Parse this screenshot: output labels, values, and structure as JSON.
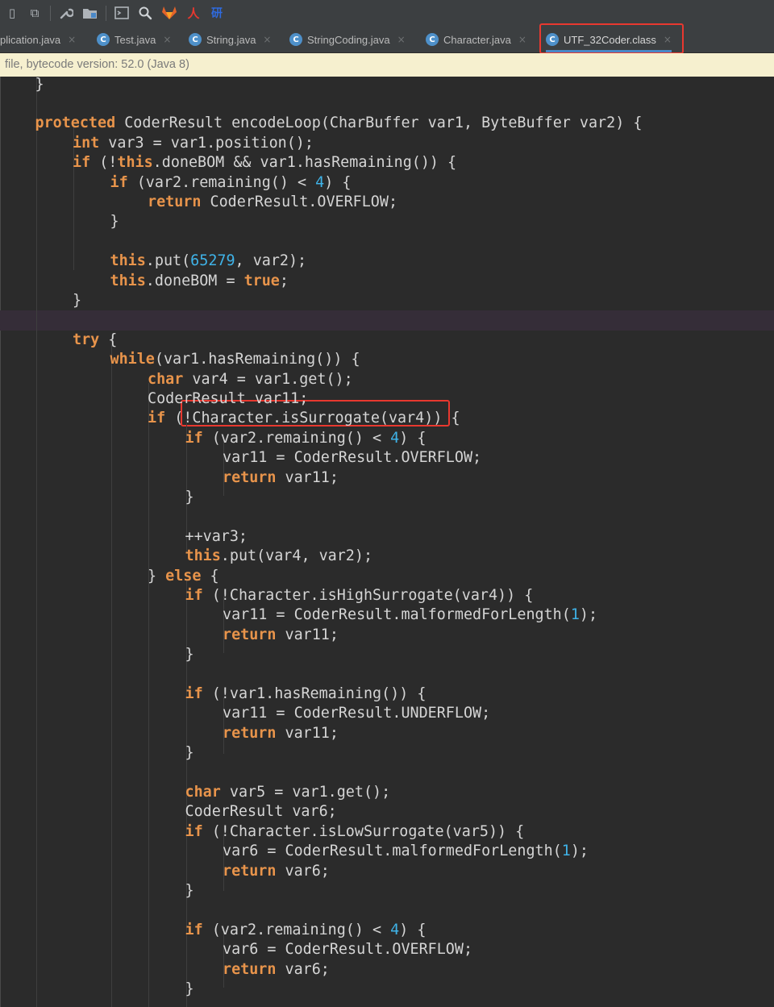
{
  "toolbar": {
    "icons": [
      "close-tab-icon",
      "fork-icon",
      "wrench-icon",
      "folder-settings-icon",
      "terminal-icon",
      "search-icon",
      "gitlab-icon",
      "translate-icon",
      "dictionary-icon"
    ]
  },
  "tabs": [
    {
      "name": "plication.java",
      "icon": false,
      "active": false
    },
    {
      "name": "Test.java",
      "icon": true,
      "active": false
    },
    {
      "name": "String.java",
      "icon": true,
      "active": false
    },
    {
      "name": "StringCoding.java",
      "icon": true,
      "active": false
    },
    {
      "name": "Character.java",
      "icon": true,
      "active": false
    },
    {
      "name": "UTF_32Coder.class",
      "icon": true,
      "active": true
    }
  ],
  "banner": {
    "text": " file, bytecode version: 52.0 (Java 8)"
  },
  "colors": {
    "highlight_box": "#e8382f",
    "keyword": "#e8944b",
    "number": "#3fb3e8",
    "text": "#d5d5d5",
    "background": "#2b2b2b"
  },
  "code": {
    "lines": [
      {
        "indent": 1,
        "tokens": [
          [
            "}",
            "p"
          ]
        ]
      },
      {
        "indent": 0,
        "tokens": []
      },
      {
        "indent": 1,
        "tokens": [
          [
            "protected",
            "k"
          ],
          [
            " CoderResult encodeLoop(CharBuffer var1, ByteBuffer var2) {",
            "p"
          ]
        ]
      },
      {
        "indent": 2,
        "tokens": [
          [
            "int",
            "k"
          ],
          [
            " var3 = var1.position();",
            "p"
          ]
        ]
      },
      {
        "indent": 2,
        "tokens": [
          [
            "if",
            "k"
          ],
          [
            " (!",
            "p"
          ],
          [
            "this",
            "k"
          ],
          [
            ".doneBOM && var1.hasRemaining()) {",
            "p"
          ]
        ]
      },
      {
        "indent": 3,
        "tokens": [
          [
            "if",
            "k"
          ],
          [
            " (var2.remaining() < ",
            "p"
          ],
          [
            "4",
            "n"
          ],
          [
            ") {",
            "p"
          ]
        ]
      },
      {
        "indent": 4,
        "tokens": [
          [
            "return",
            "k"
          ],
          [
            " CoderResult.OVERFLOW;",
            "p"
          ]
        ]
      },
      {
        "indent": 3,
        "tokens": [
          [
            "}",
            "p"
          ]
        ]
      },
      {
        "indent": 0,
        "tokens": []
      },
      {
        "indent": 3,
        "tokens": [
          [
            "this",
            "k"
          ],
          [
            ".put(",
            "p"
          ],
          [
            "65279",
            "n"
          ],
          [
            ", var2);",
            "p"
          ]
        ]
      },
      {
        "indent": 3,
        "tokens": [
          [
            "this",
            "k"
          ],
          [
            ".doneBOM = ",
            "p"
          ],
          [
            "true",
            "k"
          ],
          [
            ";",
            "p"
          ]
        ]
      },
      {
        "indent": 2,
        "tokens": [
          [
            "}",
            "p"
          ]
        ]
      },
      {
        "indent": 0,
        "tokens": [],
        "caret": true
      },
      {
        "indent": 2,
        "tokens": [
          [
            "try",
            "k"
          ],
          [
            " {",
            "p"
          ]
        ]
      },
      {
        "indent": 3,
        "tokens": [
          [
            "while",
            "k"
          ],
          [
            "(var1.hasRemaining()) {",
            "p"
          ]
        ]
      },
      {
        "indent": 4,
        "tokens": [
          [
            "char",
            "k"
          ],
          [
            " var4 = var1.get();",
            "p"
          ]
        ]
      },
      {
        "indent": 4,
        "tokens": [
          [
            "CoderResult var11;",
            "p"
          ]
        ]
      },
      {
        "indent": 4,
        "tokens": [
          [
            "if",
            "k"
          ],
          [
            " (!Character.isSurrogate(var4)) {",
            "p"
          ]
        ]
      },
      {
        "indent": 5,
        "tokens": [
          [
            "if",
            "k"
          ],
          [
            " (var2.remaining() < ",
            "p"
          ],
          [
            "4",
            "n"
          ],
          [
            ") {",
            "p"
          ]
        ]
      },
      {
        "indent": 6,
        "tokens": [
          [
            "var11 = CoderResult.OVERFLOW;",
            "p"
          ]
        ]
      },
      {
        "indent": 6,
        "tokens": [
          [
            "return",
            "k"
          ],
          [
            " var11;",
            "p"
          ]
        ]
      },
      {
        "indent": 5,
        "tokens": [
          [
            "}",
            "p"
          ]
        ]
      },
      {
        "indent": 0,
        "tokens": []
      },
      {
        "indent": 5,
        "tokens": [
          [
            "++var3;",
            "p"
          ]
        ]
      },
      {
        "indent": 5,
        "tokens": [
          [
            "this",
            "k"
          ],
          [
            ".put(var4, var2);",
            "p"
          ]
        ]
      },
      {
        "indent": 4,
        "tokens": [
          [
            "} ",
            "p"
          ],
          [
            "else",
            "k"
          ],
          [
            " {",
            "p"
          ]
        ]
      },
      {
        "indent": 5,
        "tokens": [
          [
            "if",
            "k"
          ],
          [
            " (!Character.isHighSurrogate(var4)) {",
            "p"
          ]
        ]
      },
      {
        "indent": 6,
        "tokens": [
          [
            "var11 = CoderResult.malformedForLength(",
            "p"
          ],
          [
            "1",
            "n"
          ],
          [
            ");",
            "p"
          ]
        ]
      },
      {
        "indent": 6,
        "tokens": [
          [
            "return",
            "k"
          ],
          [
            " var11;",
            "p"
          ]
        ]
      },
      {
        "indent": 5,
        "tokens": [
          [
            "}",
            "p"
          ]
        ]
      },
      {
        "indent": 0,
        "tokens": []
      },
      {
        "indent": 5,
        "tokens": [
          [
            "if",
            "k"
          ],
          [
            " (!var1.hasRemaining()) {",
            "p"
          ]
        ]
      },
      {
        "indent": 6,
        "tokens": [
          [
            "var11 = CoderResult.UNDERFLOW;",
            "p"
          ]
        ]
      },
      {
        "indent": 6,
        "tokens": [
          [
            "return",
            "k"
          ],
          [
            " var11;",
            "p"
          ]
        ]
      },
      {
        "indent": 5,
        "tokens": [
          [
            "}",
            "p"
          ]
        ]
      },
      {
        "indent": 0,
        "tokens": []
      },
      {
        "indent": 5,
        "tokens": [
          [
            "char",
            "k"
          ],
          [
            " var5 = var1.get();",
            "p"
          ]
        ]
      },
      {
        "indent": 5,
        "tokens": [
          [
            "CoderResult var6;",
            "p"
          ]
        ]
      },
      {
        "indent": 5,
        "tokens": [
          [
            "if",
            "k"
          ],
          [
            " (!Character.isLowSurrogate(var5)) {",
            "p"
          ]
        ]
      },
      {
        "indent": 6,
        "tokens": [
          [
            "var6 = CoderResult.malformedForLength(",
            "p"
          ],
          [
            "1",
            "n"
          ],
          [
            ");",
            "p"
          ]
        ]
      },
      {
        "indent": 6,
        "tokens": [
          [
            "return",
            "k"
          ],
          [
            " var6;",
            "p"
          ]
        ]
      },
      {
        "indent": 5,
        "tokens": [
          [
            "}",
            "p"
          ]
        ]
      },
      {
        "indent": 0,
        "tokens": []
      },
      {
        "indent": 5,
        "tokens": [
          [
            "if",
            "k"
          ],
          [
            " (var2.remaining() < ",
            "p"
          ],
          [
            "4",
            "n"
          ],
          [
            ") {",
            "p"
          ]
        ]
      },
      {
        "indent": 6,
        "tokens": [
          [
            "var6 = CoderResult.OVERFLOW;",
            "p"
          ]
        ]
      },
      {
        "indent": 6,
        "tokens": [
          [
            "return",
            "k"
          ],
          [
            " var6;",
            "p"
          ]
        ]
      },
      {
        "indent": 5,
        "tokens": [
          [
            "}",
            "p"
          ]
        ]
      }
    ]
  }
}
